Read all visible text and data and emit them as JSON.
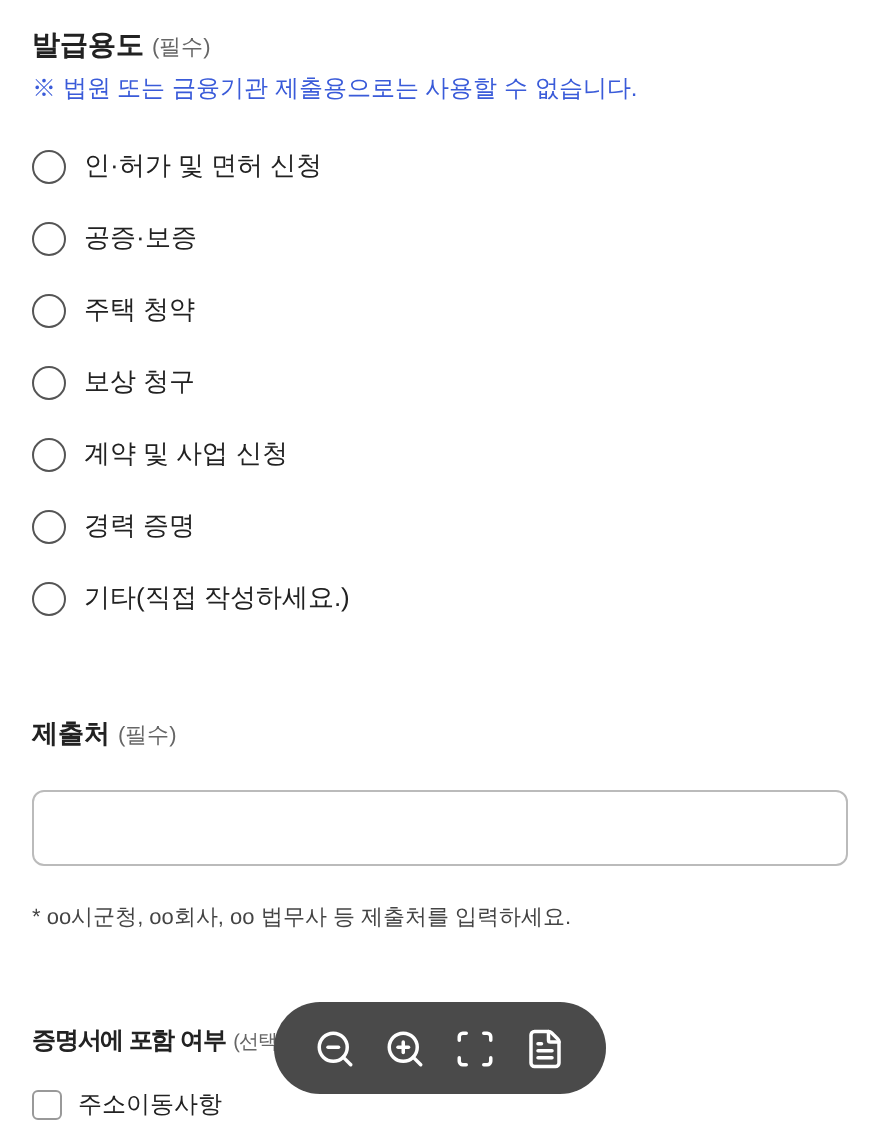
{
  "purpose": {
    "label": "발급용도",
    "required": "(필수)",
    "notice": "※ 법원 또는 금융기관 제출용으로는 사용할 수 없습니다.",
    "options": [
      {
        "label": "인·허가 및 면허 신청",
        "selected": false
      },
      {
        "label": "공증·보증",
        "selected": false
      },
      {
        "label": "주택 청약",
        "selected": false
      },
      {
        "label": "보상 청구",
        "selected": false
      },
      {
        "label": "계약 및 사업 신청",
        "selected": false
      },
      {
        "label": "경력 증명",
        "selected": false
      },
      {
        "label": "기타(직접 작성하세요.)",
        "selected": false
      }
    ]
  },
  "recipient": {
    "label": "제출처",
    "required": "(필수)",
    "hint": "* oo시군청, oo회사, oo 법무사 등 제출처를 입력하세요."
  },
  "include": {
    "label": "증명서에 포함 여부",
    "optional": "(선택",
    "options": [
      {
        "label": "주소이동사항",
        "checked": false
      }
    ]
  },
  "viewer_toolbar": [
    {
      "kind": "zoom-out"
    },
    {
      "kind": "zoom-in"
    },
    {
      "kind": "fit"
    },
    {
      "kind": "document"
    }
  ]
}
